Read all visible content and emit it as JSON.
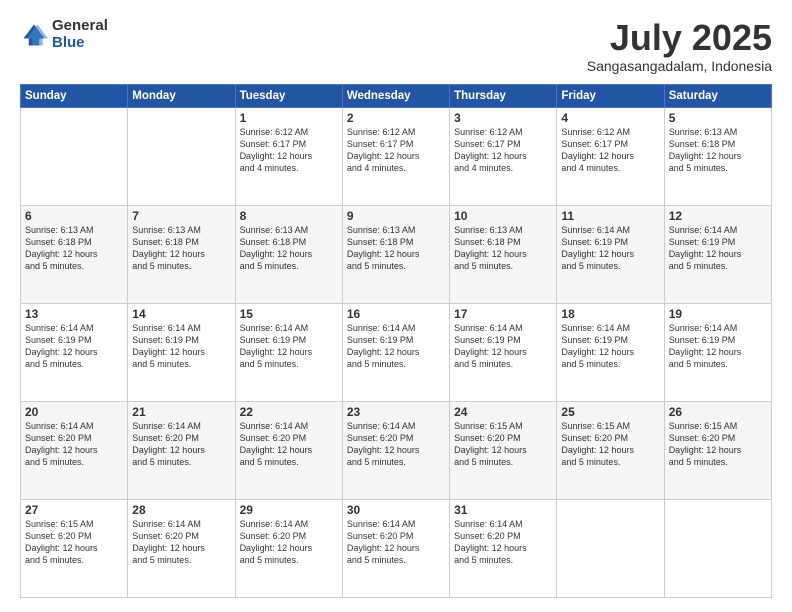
{
  "logo": {
    "general": "General",
    "blue": "Blue"
  },
  "title": {
    "month": "July 2025",
    "location": "Sangasangadalam, Indonesia"
  },
  "weekdays": [
    "Sunday",
    "Monday",
    "Tuesday",
    "Wednesday",
    "Thursday",
    "Friday",
    "Saturday"
  ],
  "weeks": [
    [
      {
        "day": "",
        "info": ""
      },
      {
        "day": "",
        "info": ""
      },
      {
        "day": "1",
        "info": "Sunrise: 6:12 AM\nSunset: 6:17 PM\nDaylight: 12 hours\nand 4 minutes."
      },
      {
        "day": "2",
        "info": "Sunrise: 6:12 AM\nSunset: 6:17 PM\nDaylight: 12 hours\nand 4 minutes."
      },
      {
        "day": "3",
        "info": "Sunrise: 6:12 AM\nSunset: 6:17 PM\nDaylight: 12 hours\nand 4 minutes."
      },
      {
        "day": "4",
        "info": "Sunrise: 6:12 AM\nSunset: 6:17 PM\nDaylight: 12 hours\nand 4 minutes."
      },
      {
        "day": "5",
        "info": "Sunrise: 6:13 AM\nSunset: 6:18 PM\nDaylight: 12 hours\nand 5 minutes."
      }
    ],
    [
      {
        "day": "6",
        "info": "Sunrise: 6:13 AM\nSunset: 6:18 PM\nDaylight: 12 hours\nand 5 minutes."
      },
      {
        "day": "7",
        "info": "Sunrise: 6:13 AM\nSunset: 6:18 PM\nDaylight: 12 hours\nand 5 minutes."
      },
      {
        "day": "8",
        "info": "Sunrise: 6:13 AM\nSunset: 6:18 PM\nDaylight: 12 hours\nand 5 minutes."
      },
      {
        "day": "9",
        "info": "Sunrise: 6:13 AM\nSunset: 6:18 PM\nDaylight: 12 hours\nand 5 minutes."
      },
      {
        "day": "10",
        "info": "Sunrise: 6:13 AM\nSunset: 6:18 PM\nDaylight: 12 hours\nand 5 minutes."
      },
      {
        "day": "11",
        "info": "Sunrise: 6:14 AM\nSunset: 6:19 PM\nDaylight: 12 hours\nand 5 minutes."
      },
      {
        "day": "12",
        "info": "Sunrise: 6:14 AM\nSunset: 6:19 PM\nDaylight: 12 hours\nand 5 minutes."
      }
    ],
    [
      {
        "day": "13",
        "info": "Sunrise: 6:14 AM\nSunset: 6:19 PM\nDaylight: 12 hours\nand 5 minutes."
      },
      {
        "day": "14",
        "info": "Sunrise: 6:14 AM\nSunset: 6:19 PM\nDaylight: 12 hours\nand 5 minutes."
      },
      {
        "day": "15",
        "info": "Sunrise: 6:14 AM\nSunset: 6:19 PM\nDaylight: 12 hours\nand 5 minutes."
      },
      {
        "day": "16",
        "info": "Sunrise: 6:14 AM\nSunset: 6:19 PM\nDaylight: 12 hours\nand 5 minutes."
      },
      {
        "day": "17",
        "info": "Sunrise: 6:14 AM\nSunset: 6:19 PM\nDaylight: 12 hours\nand 5 minutes."
      },
      {
        "day": "18",
        "info": "Sunrise: 6:14 AM\nSunset: 6:19 PM\nDaylight: 12 hours\nand 5 minutes."
      },
      {
        "day": "19",
        "info": "Sunrise: 6:14 AM\nSunset: 6:19 PM\nDaylight: 12 hours\nand 5 minutes."
      }
    ],
    [
      {
        "day": "20",
        "info": "Sunrise: 6:14 AM\nSunset: 6:20 PM\nDaylight: 12 hours\nand 5 minutes."
      },
      {
        "day": "21",
        "info": "Sunrise: 6:14 AM\nSunset: 6:20 PM\nDaylight: 12 hours\nand 5 minutes."
      },
      {
        "day": "22",
        "info": "Sunrise: 6:14 AM\nSunset: 6:20 PM\nDaylight: 12 hours\nand 5 minutes."
      },
      {
        "day": "23",
        "info": "Sunrise: 6:14 AM\nSunset: 6:20 PM\nDaylight: 12 hours\nand 5 minutes."
      },
      {
        "day": "24",
        "info": "Sunrise: 6:15 AM\nSunset: 6:20 PM\nDaylight: 12 hours\nand 5 minutes."
      },
      {
        "day": "25",
        "info": "Sunrise: 6:15 AM\nSunset: 6:20 PM\nDaylight: 12 hours\nand 5 minutes."
      },
      {
        "day": "26",
        "info": "Sunrise: 6:15 AM\nSunset: 6:20 PM\nDaylight: 12 hours\nand 5 minutes."
      }
    ],
    [
      {
        "day": "27",
        "info": "Sunrise: 6:15 AM\nSunset: 6:20 PM\nDaylight: 12 hours\nand 5 minutes."
      },
      {
        "day": "28",
        "info": "Sunrise: 6:14 AM\nSunset: 6:20 PM\nDaylight: 12 hours\nand 5 minutes."
      },
      {
        "day": "29",
        "info": "Sunrise: 6:14 AM\nSunset: 6:20 PM\nDaylight: 12 hours\nand 5 minutes."
      },
      {
        "day": "30",
        "info": "Sunrise: 6:14 AM\nSunset: 6:20 PM\nDaylight: 12 hours\nand 5 minutes."
      },
      {
        "day": "31",
        "info": "Sunrise: 6:14 AM\nSunset: 6:20 PM\nDaylight: 12 hours\nand 5 minutes."
      },
      {
        "day": "",
        "info": ""
      },
      {
        "day": "",
        "info": ""
      }
    ]
  ]
}
